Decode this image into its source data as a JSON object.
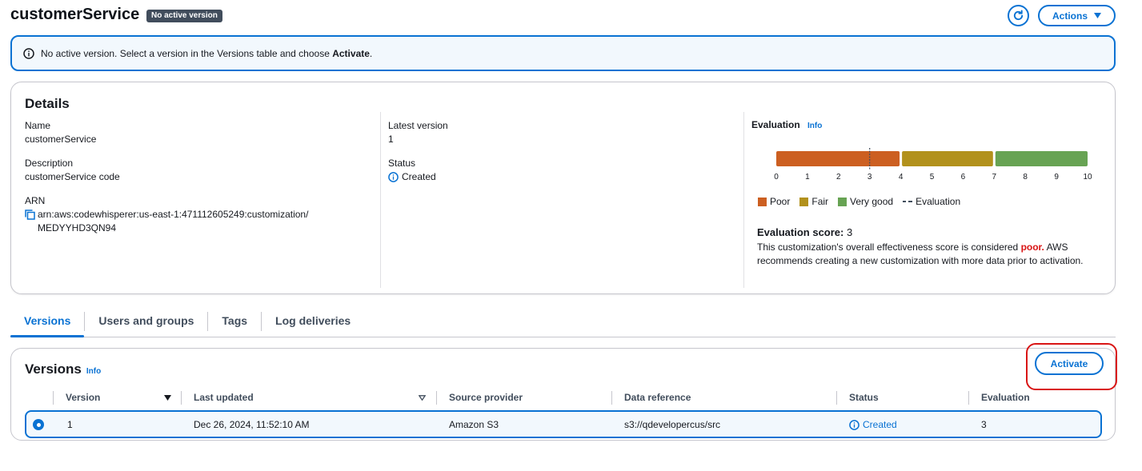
{
  "header": {
    "title": "customerService",
    "badge": "No active version",
    "actions_label": "Actions"
  },
  "alert": {
    "text_prefix": "No active version. Select a version in the Versions table and choose ",
    "text_bold": "Activate",
    "text_suffix": "."
  },
  "details": {
    "title": "Details",
    "name_label": "Name",
    "name_value": "customerService",
    "description_label": "Description",
    "description_value": "customerService code",
    "arn_label": "ARN",
    "arn_value_line1": "arn:aws:codewhisperer:us-east-1:471112605249:customization/",
    "arn_value_line2": "MEDYYHD3QN94",
    "latest_version_label": "Latest version",
    "latest_version_value": "1",
    "status_label": "Status",
    "status_value": "Created",
    "evaluation": {
      "title": "Evaluation",
      "info": "Info",
      "scale_ticks": [
        "0",
        "1",
        "2",
        "3",
        "4",
        "5",
        "6",
        "7",
        "8",
        "9",
        "10"
      ],
      "bands": [
        {
          "name": "Poor",
          "from": 0,
          "to": 4,
          "color": "#cc5f21"
        },
        {
          "name": "Fair",
          "from": 4,
          "to": 7,
          "color": "#b2911c"
        },
        {
          "name": "Very good",
          "from": 7,
          "to": 10,
          "color": "#67a353"
        }
      ],
      "marker_value": 3,
      "legend": {
        "poor": "Poor",
        "fair": "Fair",
        "very_good": "Very good",
        "evaluation": "Evaluation"
      },
      "score_heading": "Evaluation score:",
      "score_value": "3",
      "desc_prefix": "This customization's overall effectiveness score is considered ",
      "desc_bold": "poor.",
      "desc_suffix": " AWS recommends creating a new customization with more data prior to activation."
    }
  },
  "tabs": [
    {
      "label": "Versions",
      "active": true
    },
    {
      "label": "Users and groups",
      "active": false
    },
    {
      "label": "Tags",
      "active": false
    },
    {
      "label": "Log deliveries",
      "active": false
    }
  ],
  "versions": {
    "title": "Versions",
    "info": "Info",
    "activate_label": "Activate",
    "columns": [
      "Version",
      "Last updated",
      "Source provider",
      "Data reference",
      "Status",
      "Evaluation"
    ],
    "rows": [
      {
        "version": "1",
        "last_updated": "Dec 26, 2024, 11:52:10 AM",
        "source_provider": "Amazon S3",
        "data_reference": "s3://qdevelopercus/src",
        "status": "Created",
        "evaluation": "3"
      }
    ]
  },
  "colors": {
    "accent": "#0972d3",
    "highlight_outline": "#d91515",
    "poor": "#cc5f21",
    "fair": "#b2911c",
    "very_good": "#67a353"
  }
}
